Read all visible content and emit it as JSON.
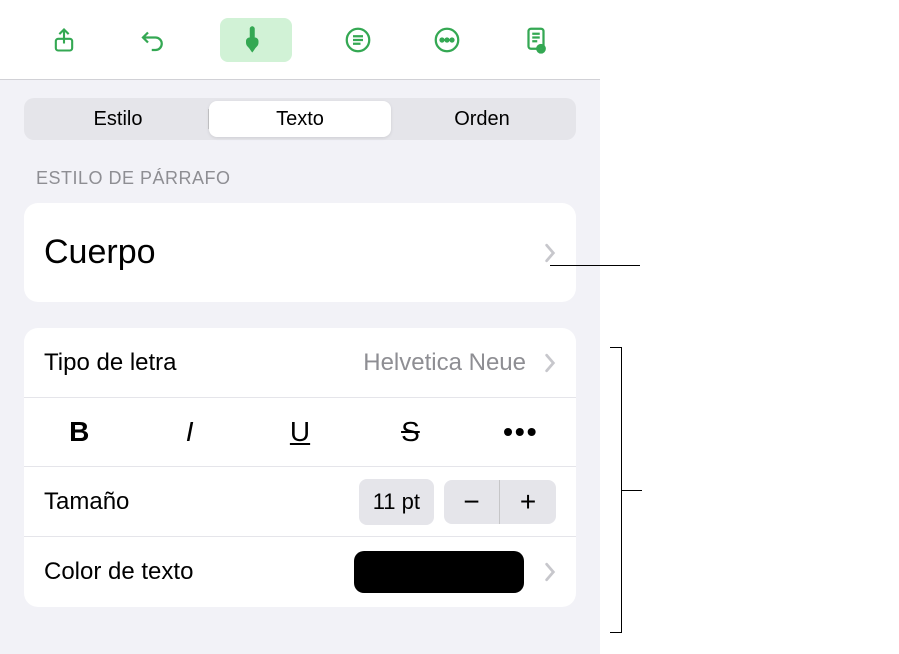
{
  "segmented": {
    "style": "Estilo",
    "text": "Texto",
    "order": "Orden"
  },
  "paragraph_style": {
    "header": "ESTILO DE PÁRRAFO",
    "value": "Cuerpo"
  },
  "font": {
    "label": "Tipo de letra",
    "value": "Helvetica Neue"
  },
  "format": {
    "bold": "B",
    "italic": "I",
    "underline": "U",
    "strike": "S"
  },
  "size": {
    "label": "Tamaño",
    "value": "11 pt"
  },
  "color": {
    "label": "Color de texto",
    "value": "#000000"
  }
}
